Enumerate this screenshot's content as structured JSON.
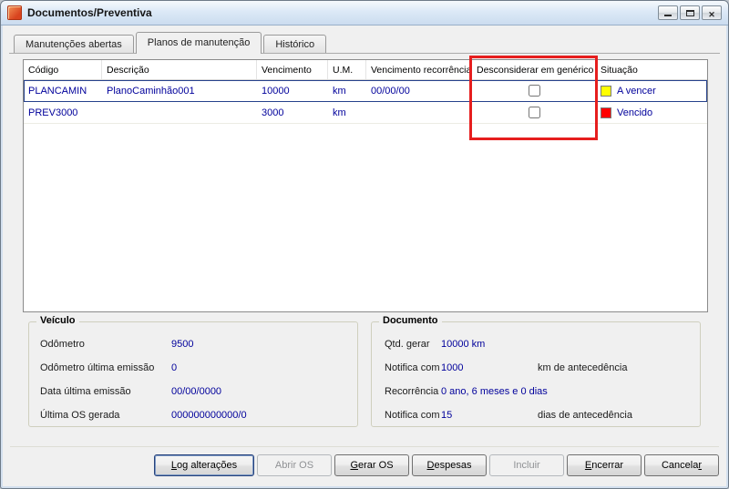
{
  "window": {
    "title": "Documentos/Preventiva"
  },
  "tabs": [
    {
      "label": "Manutenções abertas"
    },
    {
      "label": "Planos de manutenção"
    },
    {
      "label": "Histórico"
    }
  ],
  "grid": {
    "columns": [
      "Código",
      "Descrição",
      "Vencimento",
      "U.M.",
      "Vencimento recorrência",
      "Desconsiderar em genérico",
      "Situação"
    ],
    "rows": [
      {
        "codigo": "PLANCAMIN",
        "descricao": "PlanoCaminhão001",
        "vencimento": "10000",
        "um": "km",
        "vencimento_recorrencia": "00/00/00",
        "desconsiderar": false,
        "situacao": "A vencer",
        "situacao_color": "#FFFF00",
        "selected": true
      },
      {
        "codigo": "PREV3000",
        "descricao": "",
        "vencimento": "3000",
        "um": "km",
        "vencimento_recorrencia": "",
        "desconsiderar": false,
        "situacao": "Vencido",
        "situacao_color": "#FF0000",
        "selected": false
      }
    ]
  },
  "veiculo": {
    "title": "Veículo",
    "fields": [
      {
        "label": "Odômetro",
        "value": "9500"
      },
      {
        "label": "Odômetro última emissão",
        "value": "0"
      },
      {
        "label": "Data última emissão",
        "value": "00/00/0000"
      },
      {
        "label": "Última OS gerada",
        "value": "000000000000/0"
      }
    ]
  },
  "documento": {
    "title": "Documento",
    "fields": [
      {
        "label": "Qtd. gerar",
        "value": "10000 km",
        "suffix": ""
      },
      {
        "label": "Notifica com",
        "value": "1000",
        "suffix": "km de antecedência"
      },
      {
        "label": "Recorrência",
        "value": "0 ano, 6 meses e 0 dias",
        "suffix": ""
      },
      {
        "label": "Notifica com",
        "value": "15",
        "suffix": "dias de antecedência"
      }
    ]
  },
  "buttons": [
    {
      "label": "Log alterações",
      "accel": "L",
      "enabled": true,
      "default": true
    },
    {
      "label": "Abrir OS",
      "accel": "A",
      "enabled": false,
      "default": false
    },
    {
      "label": "Gerar OS",
      "accel": "G",
      "enabled": true,
      "default": false
    },
    {
      "label": "Despesas",
      "accel": "D",
      "enabled": true,
      "default": false
    },
    {
      "label": "Incluir",
      "accel": "I",
      "enabled": false,
      "default": false
    },
    {
      "label": "Encerrar",
      "accel": "E",
      "enabled": true,
      "default": false
    },
    {
      "label": "Cancelar",
      "accel": "r",
      "enabled": true,
      "default": false
    }
  ],
  "annotation": {
    "highlight_color": "#E61E1E"
  },
  "colors": {
    "value_text": "#00009B",
    "status_yellow": "#FFFF00",
    "status_red": "#FF0000"
  }
}
